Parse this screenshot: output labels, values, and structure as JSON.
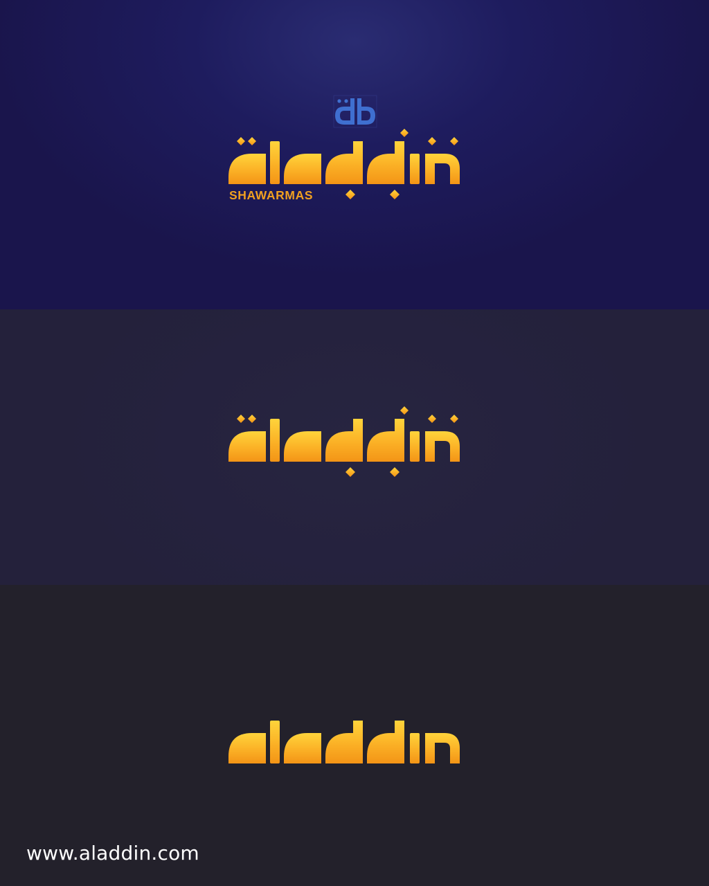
{
  "brand": {
    "wordmark": "aladdin",
    "tagline": "SHAWARMAS",
    "monogram": "db",
    "website": "www.aladdin.com"
  },
  "variants": [
    {
      "name": "full-logo-with-tagline",
      "background": "#1d1a57"
    },
    {
      "name": "logo-with-dots",
      "background": "#25223e"
    },
    {
      "name": "plain-wordmark",
      "background": "#23212b"
    }
  ],
  "colors": {
    "gold_light": "#ffd23a",
    "gold_dark": "#f39a16",
    "monogram_blue": "#3f6fd0",
    "text_white": "#ffffff"
  },
  "icons": [
    "diamond-dot-icon",
    "db-monogram-icon"
  ]
}
